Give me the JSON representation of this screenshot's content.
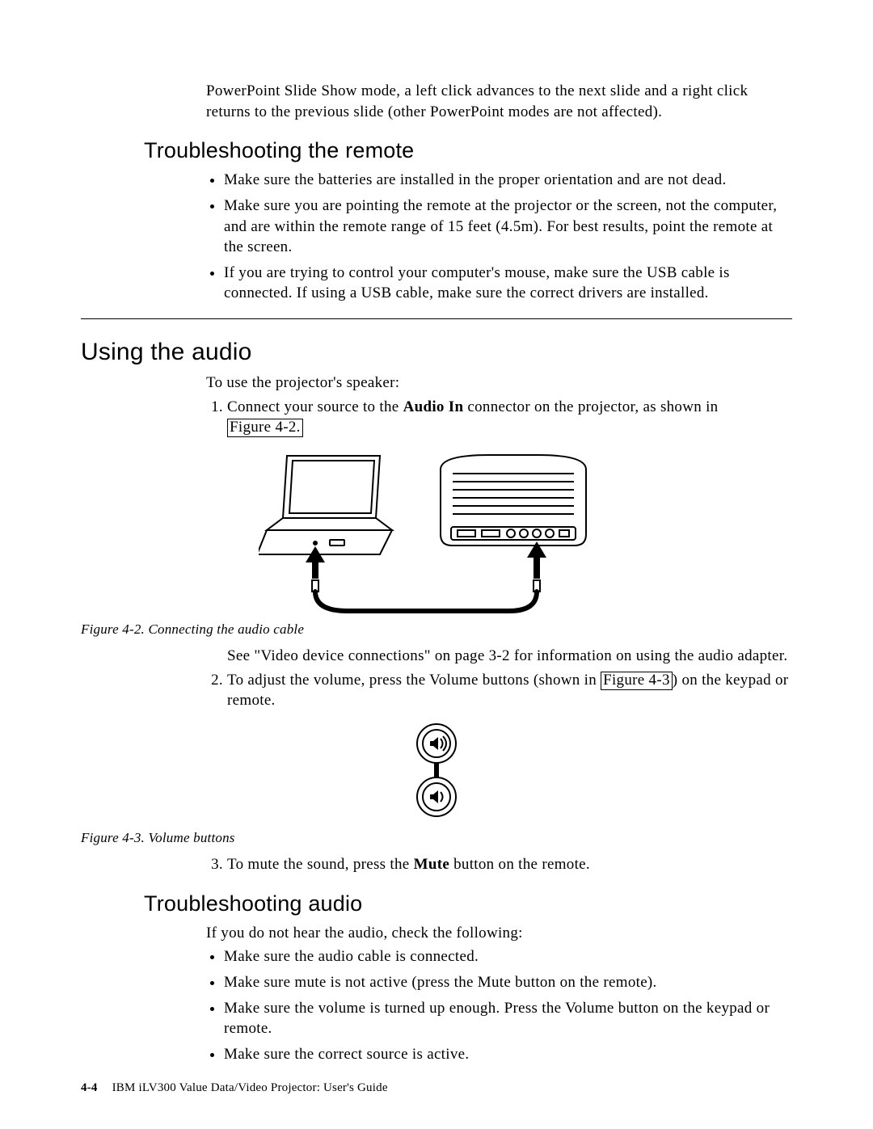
{
  "intro_para": "PowerPoint Slide Show mode, a left click advances to the next slide and a right click returns to the previous slide (other PowerPoint modes are not affected).",
  "h_troubleshoot_remote": "Troubleshooting the remote",
  "remote_bullets": [
    "Make sure the batteries are installed in the proper orientation and are not dead.",
    "Make sure you are pointing the remote at the projector or the screen, not the computer, and are within the remote range of 15 feet (4.5m). For best results, point the remote at the screen.",
    "If you are trying to control your computer's mouse, make sure the USB cable is connected. If using a USB cable, make sure the correct drivers are installed."
  ],
  "h_using_audio": "Using the audio",
  "audio_intro": "To use the projector's speaker:",
  "step1_pre": "Connect your source to the ",
  "step1_bold": "Audio In",
  "step1_post": " connector on the projector, as shown in ",
  "step1_link": "Figure 4-2.",
  "fig42_caption": "Figure 4-2. Connecting the audio cable",
  "after_fig42_para": "See \"Video device connections\" on page 3-2 for information on using the audio adapter.",
  "step2_pre": "To adjust the volume, press the Volume buttons (shown in ",
  "step2_link": "Figure 4-3",
  "step2_post": ") on the keypad or remote.",
  "fig43_caption": "Figure 4-3. Volume buttons",
  "step3_pre": "To mute the sound, press the ",
  "step3_bold": "Mute",
  "step3_post": " button on the remote.",
  "h_troubleshoot_audio": "Troubleshooting audio",
  "audio_trouble_intro": "If you do not hear the audio, check the following:",
  "audio_trouble_bullets": [
    "Make sure the audio cable is connected.",
    "Make sure mute is not active (press the Mute button on the remote).",
    "Make sure the volume is turned up enough. Press the Volume button on the keypad or remote.",
    "Make sure the correct source is active."
  ],
  "footer_page": "4-4",
  "footer_text": "IBM iLV300 Value Data/Video Projector: User's Guide"
}
